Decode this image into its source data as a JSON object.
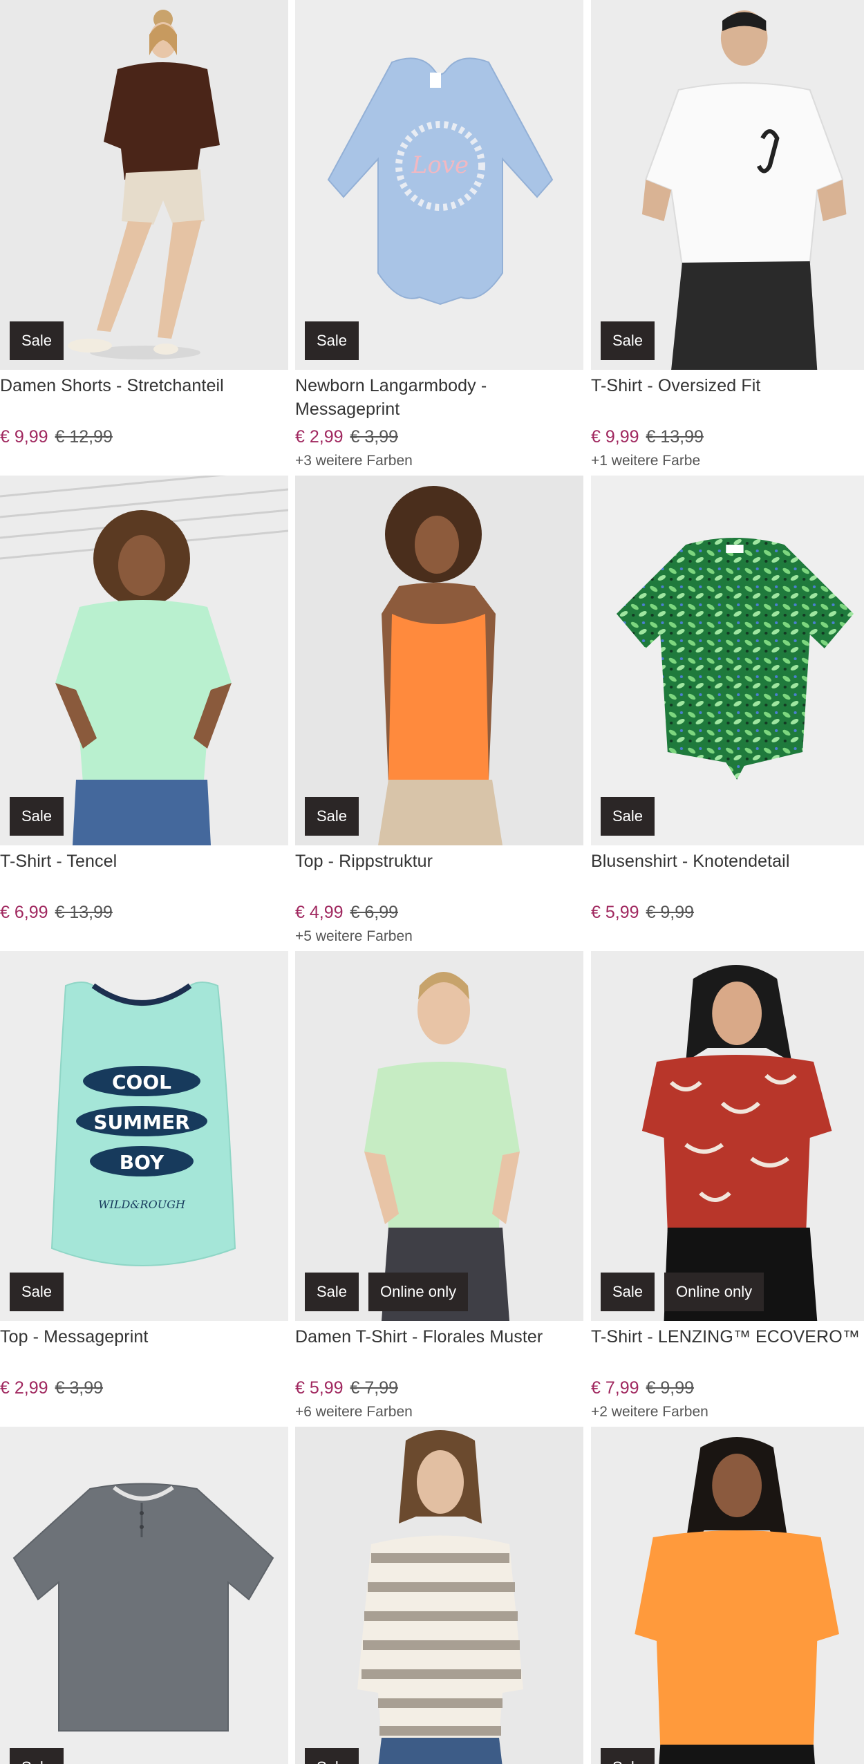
{
  "products": [
    {
      "title": "Damen Shorts - Stretchanteil",
      "price": "€ 9,99",
      "old_price": "€ 12,99",
      "colors": "",
      "badges": [
        "Sale"
      ],
      "image": "woman-brown-sweater-shorts"
    },
    {
      "title": "Newborn Langarmbody - Messageprint",
      "price": "€ 2,99",
      "old_price": "€ 3,99",
      "colors": "+3 weitere Farben",
      "badges": [
        "Sale"
      ],
      "image": "baby-bodysuit-blue",
      "print": "Love"
    },
    {
      "title": "T-Shirt - Oversized Fit",
      "price": "€ 9,99",
      "old_price": "€ 13,99",
      "colors": "+1 weitere Farbe",
      "badges": [
        "Sale"
      ],
      "image": "man-white-tshirt-scorpion"
    },
    {
      "title": "T-Shirt - Tencel",
      "price": "€ 6,99",
      "old_price": "€ 13,99",
      "colors": "",
      "badges": [
        "Sale"
      ],
      "image": "woman-mint-tshirt"
    },
    {
      "title": "Top - Rippstruktur",
      "price": "€ 4,99",
      "old_price": "€ 6,99",
      "colors": "+5 weitere Farben",
      "badges": [
        "Sale"
      ],
      "image": "woman-orange-tank"
    },
    {
      "title": "Blusenshirt - Knotendetail",
      "price": "€ 5,99",
      "old_price": "€ 9,99",
      "colors": "",
      "badges": [
        "Sale"
      ],
      "image": "green-print-blouse"
    },
    {
      "title": "Top - Messageprint",
      "price": "€ 2,99",
      "old_price": "€ 3,99",
      "colors": "",
      "badges": [
        "Sale"
      ],
      "image": "boys-tank-cool-summer-boy",
      "print": [
        "COOL",
        "SUMMER",
        "BOY",
        "WILD&ROUGH"
      ]
    },
    {
      "title": "Damen T-Shirt - Florales Muster",
      "price": "€ 5,99",
      "old_price": "€ 7,99",
      "colors": "+6 weitere Farben",
      "badges": [
        "Sale",
        "Online only"
      ],
      "image": "woman-mint-lace-tshirt"
    },
    {
      "title": "T-Shirt - LENZING™ ECOVERO™",
      "price": "€ 7,99",
      "old_price": "€ 9,99",
      "colors": "+2 weitere Farben",
      "badges": [
        "Sale",
        "Online only"
      ],
      "image": "woman-red-print-tshirt"
    },
    {
      "title": "",
      "price": "",
      "old_price": "",
      "colors": "",
      "badges": [
        "Sale"
      ],
      "image": "grey-henley-tshirt"
    },
    {
      "title": "",
      "price": "",
      "old_price": "",
      "colors": "",
      "badges": [
        "Sale"
      ],
      "image": "woman-striped-sweater"
    },
    {
      "title": "",
      "price": "",
      "old_price": "",
      "colors": "",
      "badges": [
        "Sale"
      ],
      "image": "woman-orange-tshirt"
    }
  ],
  "colors": {
    "price_sale": "#a0285f",
    "badge_bg": "#2b2626",
    "text": "#333333"
  }
}
